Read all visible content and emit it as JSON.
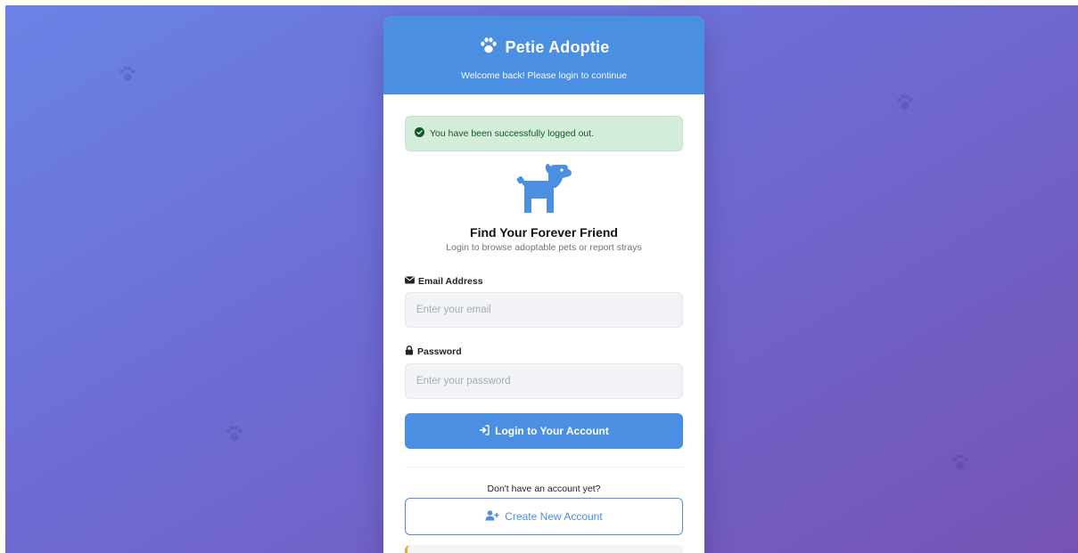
{
  "header": {
    "brand_title": "Petie Adoptie",
    "subtitle": "Welcome back! Please login to continue",
    "logo_icon": "paw-icon"
  },
  "alert": {
    "message": "You have been successfully logged out.",
    "icon": "check-circle-icon"
  },
  "hero": {
    "icon": "dog-icon",
    "title": "Find Your Forever Friend",
    "subtitle": "Login to browse adoptable pets or report strays"
  },
  "form": {
    "email": {
      "label": "Email Address",
      "icon": "envelope-icon",
      "value": "",
      "placeholder": "Enter your email"
    },
    "password": {
      "label": "Password",
      "icon": "lock-icon",
      "value": "",
      "placeholder": "Enter your password"
    },
    "submit_label": "Login to Your Account",
    "submit_icon": "sign-in-icon"
  },
  "signup": {
    "prompt": "Don't have an account yet?",
    "button_label": "Create New Account",
    "button_icon": "user-plus-icon"
  },
  "colors": {
    "primary": "#4b8fe2",
    "success_bg": "#d4edda",
    "success_text": "#155724",
    "background_start": "#6a83e6",
    "background_end": "#7553b4",
    "warning_accent": "#f0a53a"
  }
}
